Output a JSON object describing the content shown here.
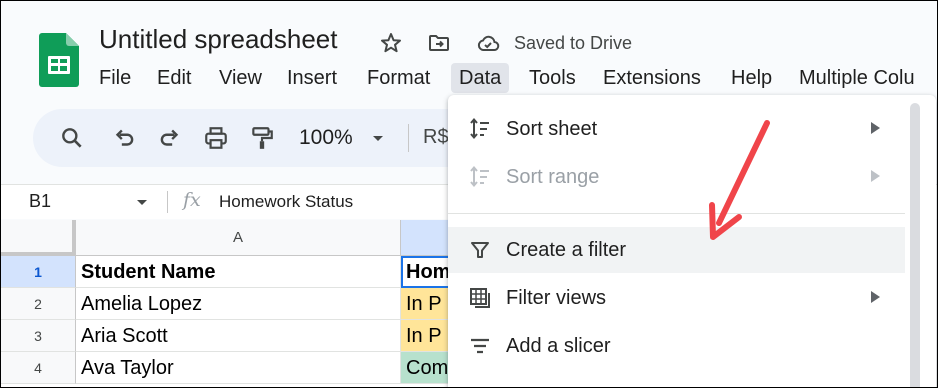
{
  "doc": {
    "title": "Untitled spreadsheet",
    "save_status": "Saved to Drive"
  },
  "menu": [
    "File",
    "Edit",
    "View",
    "Insert",
    "Format",
    "Data",
    "Tools",
    "Extensions",
    "Help",
    "Multiple Colu"
  ],
  "menu_active": "Data",
  "toolbar": {
    "zoom": "100%",
    "currency": "R$"
  },
  "formula_bar": {
    "cell_ref": "B1",
    "fx": "fx",
    "content": "Homework Status"
  },
  "grid": {
    "columns": [
      "A",
      ""
    ],
    "rows": [
      {
        "num": "1",
        "a": "Student Name",
        "b": "Hom"
      },
      {
        "num": "2",
        "a": "Amelia Lopez",
        "b": "In P"
      },
      {
        "num": "3",
        "a": "Aria Scott",
        "b": "In P"
      },
      {
        "num": "4",
        "a": "Ava Taylor",
        "b": "Com"
      }
    ],
    "cell_colors": {
      "in_progress": "#ffe599",
      "complete": "#b7e1cd"
    }
  },
  "data_menu": {
    "items": [
      {
        "label": "Sort sheet",
        "icon": "sort-icon",
        "submenu": true,
        "disabled": false
      },
      {
        "label": "Sort range",
        "icon": "sort-icon",
        "submenu": true,
        "disabled": true
      },
      {
        "label": "Create a filter",
        "icon": "filter-icon",
        "submenu": false,
        "disabled": false,
        "highlighted": true
      },
      {
        "label": "Filter views",
        "icon": "filter-views-icon",
        "submenu": true,
        "disabled": false
      },
      {
        "label": "Add a slicer",
        "icon": "slicer-icon",
        "submenu": false,
        "disabled": false
      }
    ]
  },
  "colors": {
    "accent": "#1a73e8",
    "annotation_arrow": "#f0454a"
  }
}
